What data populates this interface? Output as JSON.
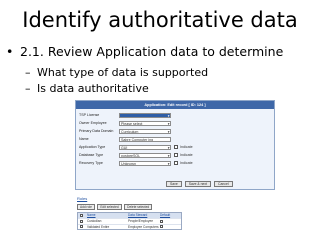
{
  "slide": {
    "title": "Identify authoritative data",
    "bullet_marker": "•",
    "bullet": "2.1. Review Application data to determine",
    "sub_marker": "–",
    "sub_items": [
      "What type of data is supported",
      "Is data authoritative"
    ]
  },
  "screenshot": {
    "form_title": "Application: Edit record [ ID: 124 ]",
    "fields": [
      {
        "label": "TSP License",
        "value": ""
      },
      {
        "label": "Owner Employee",
        "value": "Please select"
      },
      {
        "label": "Primary Data Domain",
        "value": "Curriculum"
      },
      {
        "label": "Name",
        "value": "Sabre Computer ing"
      },
      {
        "label": "Application Type",
        "value": "GUI",
        "check_label": "Indicate"
      },
      {
        "label": "Database Type",
        "value": "postgreSQL",
        "check_label": "Indicate"
      },
      {
        "label": "Recovery Type",
        "value": "Unknown",
        "check_label": "Indicate"
      }
    ],
    "form_buttons": [
      "Save",
      "Save &amp; next",
      "Cancel"
    ],
    "roles_heading": "Roles",
    "roles_toolbar": [
      "Add role",
      "Edit selected",
      "Delete selected"
    ],
    "roles_columns": [
      "Name",
      "Data Steward",
      "Default"
    ],
    "roles_rows": [
      {
        "name": "Custodian",
        "desc": "People/Employee"
      },
      {
        "name": "Validated Entire",
        "desc": "Employee Computers"
      }
    ]
  }
}
